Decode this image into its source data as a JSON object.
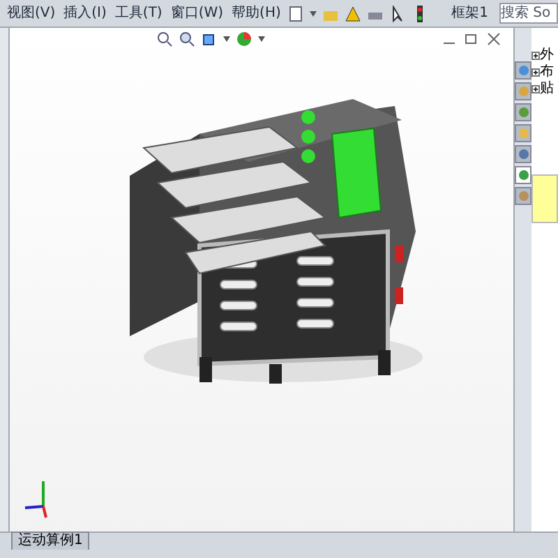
{
  "menu": [
    "视图(V)",
    "插入(I)",
    "工具(T)",
    "窗口(W)",
    "帮助(H)"
  ],
  "document_title": "框架1",
  "search": {
    "placeholder": "搜索 So"
  },
  "task_pane": {
    "tabs": [
      {
        "selected": false
      },
      {
        "selected": false
      },
      {
        "selected": false
      },
      {
        "selected": false
      },
      {
        "selected": false
      },
      {
        "selected": true
      },
      {
        "selected": false
      }
    ],
    "tree": [
      {
        "label": "外",
        "expanded": false
      },
      {
        "label": "布",
        "expanded": false
      },
      {
        "label": "贴",
        "expanded": false
      }
    ]
  },
  "bottom_tabs": [
    {
      "label": "运动算例1",
      "selected": false
    }
  ]
}
